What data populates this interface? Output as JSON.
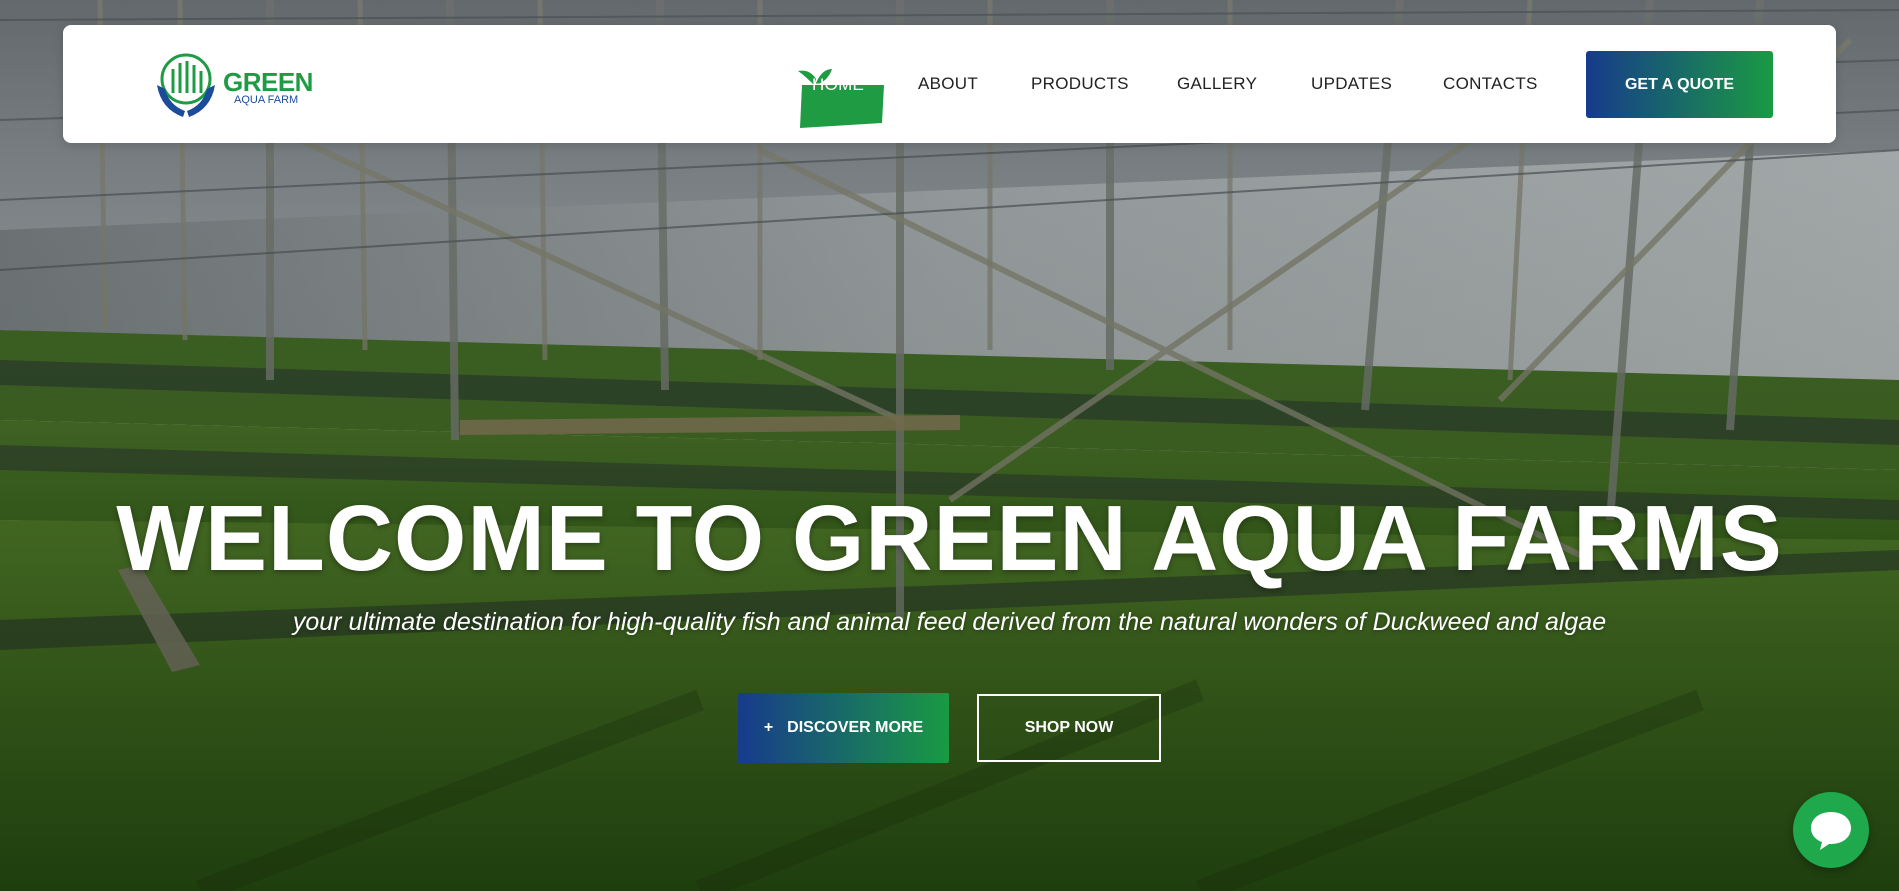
{
  "brand": {
    "name": "GREEN",
    "tagline": "AQUA FARM",
    "primary_color": "#1a9a43",
    "secondary_color": "#173b8c"
  },
  "nav": {
    "items": [
      {
        "label": "HOME",
        "active": true
      },
      {
        "label": "ABOUT"
      },
      {
        "label": "PRODUCTS"
      },
      {
        "label": "GALLERY"
      },
      {
        "label": "UPDATES"
      },
      {
        "label": "CONTACTS"
      }
    ],
    "quote_button": "GET A QUOTE"
  },
  "hero": {
    "title": "WELCOME TO GREEN AQUA FARMS",
    "subtitle": "your ultimate destination for high-quality fish and animal feed derived from the natural wonders of Duckweed and algae",
    "discover_icon": "+",
    "discover_label": "DISCOVER MORE",
    "shop_label": "SHOP NOW"
  },
  "chat": {
    "icon": "chat-bubble-icon"
  }
}
